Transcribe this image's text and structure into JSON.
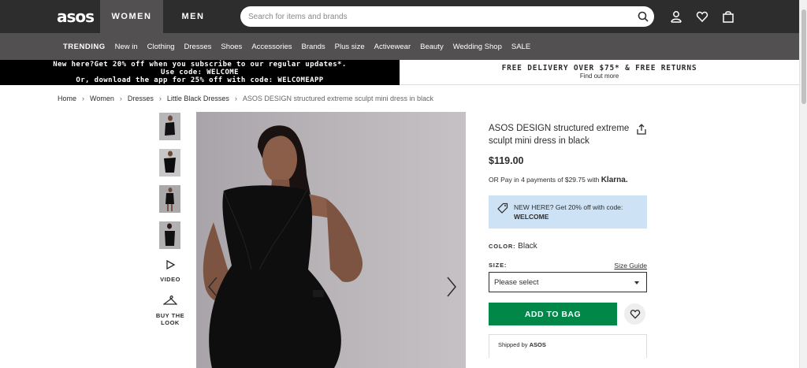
{
  "header": {
    "logo": "asos",
    "tabs": [
      {
        "label": "WOMEN"
      },
      {
        "label": "MEN"
      }
    ],
    "search": {
      "placeholder": "Search for items and brands"
    },
    "icons": [
      "search-icon",
      "account-icon",
      "heart-icon",
      "bag-icon"
    ]
  },
  "categories": [
    {
      "label": "TRENDING"
    },
    {
      "label": "New in"
    },
    {
      "label": "Clothing"
    },
    {
      "label": "Dresses"
    },
    {
      "label": "Shoes"
    },
    {
      "label": "Accessories"
    },
    {
      "label": "Brands"
    },
    {
      "label": "Plus size"
    },
    {
      "label": "Activewear"
    },
    {
      "label": "Beauty"
    },
    {
      "label": "Wedding Shop"
    },
    {
      "label": "SALE"
    }
  ],
  "promo": {
    "left_line1": "New here?Get 20% off when you subscribe to our regular updates*.",
    "left_line2": "Use code: WELCOME",
    "left_line3": "Or, download the app for 25% off with code: WELCOMEAPP",
    "right_title": "FREE DELIVERY OVER $75* & FREE RETURNS",
    "right_link": "Find out more"
  },
  "breadcrumb": {
    "items": [
      "Home",
      "Women",
      "Dresses",
      "Little Black Dresses"
    ],
    "current": "ASOS DESIGN structured extreme sculpt mini dress in black",
    "separator": "›"
  },
  "gallery": {
    "video_label": "VIDEO",
    "buy_look_line1": "BUY THE",
    "buy_look_line2": "LOOK"
  },
  "product": {
    "title": "ASOS DESIGN structured extreme sculpt mini dress in black",
    "price": "$119.00",
    "klarna_text": "OR Pay in 4 payments of $29.75 with",
    "klarna_brand": "Klarna.",
    "newhere_text": "NEW HERE? Get 20% off with code:",
    "newhere_code": "WELCOME",
    "color_label": "COLOR:",
    "color_value": "Black",
    "size_label": "SIZE:",
    "size_guide": "Size Guide",
    "size_placeholder": "Please select",
    "add_to_bag": "ADD TO BAG",
    "shipped_by_label": "Shipped by",
    "shipped_by_value": "ASOS"
  },
  "colors": {
    "header_bg": "#2d2d2d",
    "nav_bg": "#525050",
    "add_bag": "#018849",
    "promo_blue": "#cde2f5"
  }
}
